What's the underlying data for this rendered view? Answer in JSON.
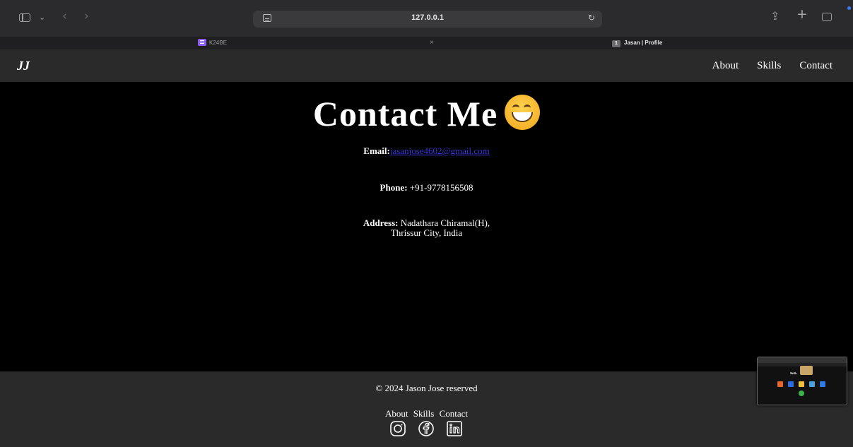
{
  "browser": {
    "url": "127.0.0.1",
    "tabs": [
      {
        "label": "K24BE"
      },
      {
        "label": "×"
      },
      {
        "badge": "1",
        "label": "Jasan | Profile"
      }
    ]
  },
  "site": {
    "logo": "JJ",
    "nav": [
      "About",
      "Skills",
      "Contact"
    ]
  },
  "contact": {
    "title": "Contact Me",
    "email_label": "Email:",
    "email_value": "jasanjose4602@gmail.com",
    "phone_label": "Phone:",
    "phone_value": " +91-9778156508",
    "address_label": "Address:",
    "address_line1": " Nadathara Chiramal(H),",
    "address_line2": "Thrissur City, India"
  },
  "footer": {
    "copyright": "© 2024 Jason Jose reserved",
    "links": [
      "About",
      "Skills",
      "Contact"
    ],
    "social": [
      "instagram-icon",
      "facebook-icon",
      "linkedin-icon"
    ]
  },
  "colors": {
    "background": "#000000",
    "nav_bg": "#2a2a2a",
    "link": "#3a35e0",
    "text": "#ffffff"
  }
}
